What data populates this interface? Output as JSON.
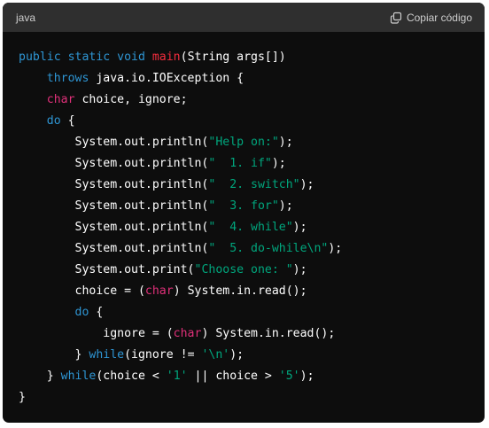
{
  "header": {
    "language": "java",
    "copy_label": "Copiar código"
  },
  "colors": {
    "background": "#0d0d0d",
    "header": "#2f2f2f",
    "keyword": "#2e95d3",
    "function": "#f22c3d",
    "type": "#df3079",
    "string": "#00a67d",
    "text": "#ffffff"
  },
  "code": {
    "lines": [
      [
        {
          "t": "public static void ",
          "c": "kw"
        },
        {
          "t": "main",
          "c": "fn"
        },
        {
          "t": "(String args[])",
          "c": "pl"
        }
      ],
      [
        {
          "t": "    ",
          "c": "pl"
        },
        {
          "t": "throws",
          "c": "kw"
        },
        {
          "t": " java.io.IOException {",
          "c": "pl"
        }
      ],
      [
        {
          "t": "    ",
          "c": "pl"
        },
        {
          "t": "char",
          "c": "ty"
        },
        {
          "t": " choice, ignore;",
          "c": "pl"
        }
      ],
      [
        {
          "t": "    ",
          "c": "pl"
        },
        {
          "t": "do",
          "c": "kw"
        },
        {
          "t": " {",
          "c": "pl"
        }
      ],
      [
        {
          "t": "        System.out.println(",
          "c": "pl"
        },
        {
          "t": "\"Help on:\"",
          "c": "str"
        },
        {
          "t": ");",
          "c": "pl"
        }
      ],
      [
        {
          "t": "        System.out.println(",
          "c": "pl"
        },
        {
          "t": "\"  1. if\"",
          "c": "str"
        },
        {
          "t": ");",
          "c": "pl"
        }
      ],
      [
        {
          "t": "        System.out.println(",
          "c": "pl"
        },
        {
          "t": "\"  2. switch\"",
          "c": "str"
        },
        {
          "t": ");",
          "c": "pl"
        }
      ],
      [
        {
          "t": "        System.out.println(",
          "c": "pl"
        },
        {
          "t": "\"  3. for\"",
          "c": "str"
        },
        {
          "t": ");",
          "c": "pl"
        }
      ],
      [
        {
          "t": "        System.out.println(",
          "c": "pl"
        },
        {
          "t": "\"  4. while\"",
          "c": "str"
        },
        {
          "t": ");",
          "c": "pl"
        }
      ],
      [
        {
          "t": "        System.out.println(",
          "c": "pl"
        },
        {
          "t": "\"  5. do-while\\n\"",
          "c": "str"
        },
        {
          "t": ");",
          "c": "pl"
        }
      ],
      [
        {
          "t": "        System.out.print(",
          "c": "pl"
        },
        {
          "t": "\"Choose one: \"",
          "c": "str"
        },
        {
          "t": ");",
          "c": "pl"
        }
      ],
      [
        {
          "t": "        choice = (",
          "c": "pl"
        },
        {
          "t": "char",
          "c": "ty"
        },
        {
          "t": ") System.in.read();",
          "c": "pl"
        }
      ],
      [
        {
          "t": "        ",
          "c": "pl"
        },
        {
          "t": "do",
          "c": "kw"
        },
        {
          "t": " {",
          "c": "pl"
        }
      ],
      [
        {
          "t": "            ignore = (",
          "c": "pl"
        },
        {
          "t": "char",
          "c": "ty"
        },
        {
          "t": ") System.in.read();",
          "c": "pl"
        }
      ],
      [
        {
          "t": "        } ",
          "c": "pl"
        },
        {
          "t": "while",
          "c": "kw"
        },
        {
          "t": "(ignore != ",
          "c": "pl"
        },
        {
          "t": "'\\n'",
          "c": "str"
        },
        {
          "t": ");",
          "c": "pl"
        }
      ],
      [
        {
          "t": "    } ",
          "c": "pl"
        },
        {
          "t": "while",
          "c": "kw"
        },
        {
          "t": "(choice < ",
          "c": "pl"
        },
        {
          "t": "'1'",
          "c": "str"
        },
        {
          "t": " || choice > ",
          "c": "pl"
        },
        {
          "t": "'5'",
          "c": "str"
        },
        {
          "t": ");",
          "c": "pl"
        }
      ],
      [
        {
          "t": "}",
          "c": "pl"
        }
      ]
    ]
  }
}
